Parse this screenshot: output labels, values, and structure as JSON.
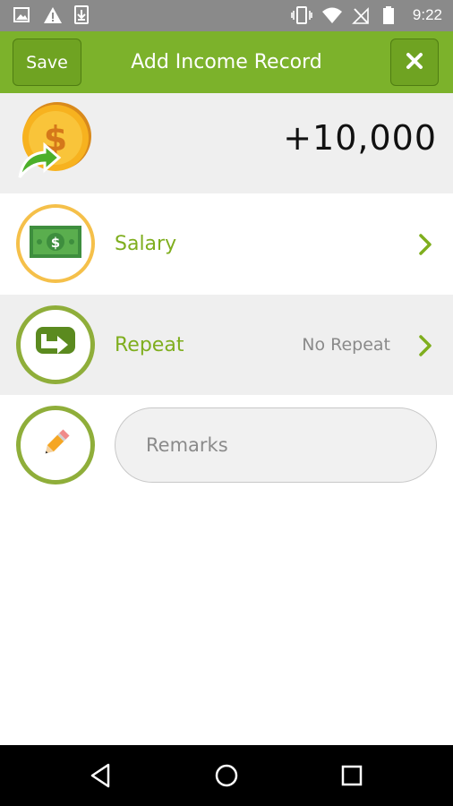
{
  "status_bar": {
    "time": "9:22",
    "icons_left": [
      "image-icon",
      "warning-icon",
      "download-icon"
    ],
    "icons_right": [
      "vibrate-icon",
      "wifi-icon",
      "no-signal-icon",
      "battery-icon"
    ]
  },
  "header": {
    "save_label": "Save",
    "title": "Add Income Record",
    "close_icon": "close-icon"
  },
  "amount": {
    "value": "+10,000",
    "icon": "income-coin-icon"
  },
  "category": {
    "label": "Salary",
    "icon": "cash-bill-icon"
  },
  "repeat": {
    "label": "Repeat",
    "value": "No Repeat",
    "icon": "repeat-arrow-icon"
  },
  "remarks": {
    "placeholder": "Remarks",
    "value": "",
    "icon": "pencil-icon"
  },
  "colors": {
    "brand_green": "#7cb22b",
    "label_green": "#7fae1e",
    "ring_yellow": "#f5c04a",
    "ring_green": "#8fae3a",
    "row_gray": "#efefef"
  },
  "nav_bar": {
    "buttons": [
      "back-icon",
      "home-icon",
      "recents-icon"
    ]
  }
}
